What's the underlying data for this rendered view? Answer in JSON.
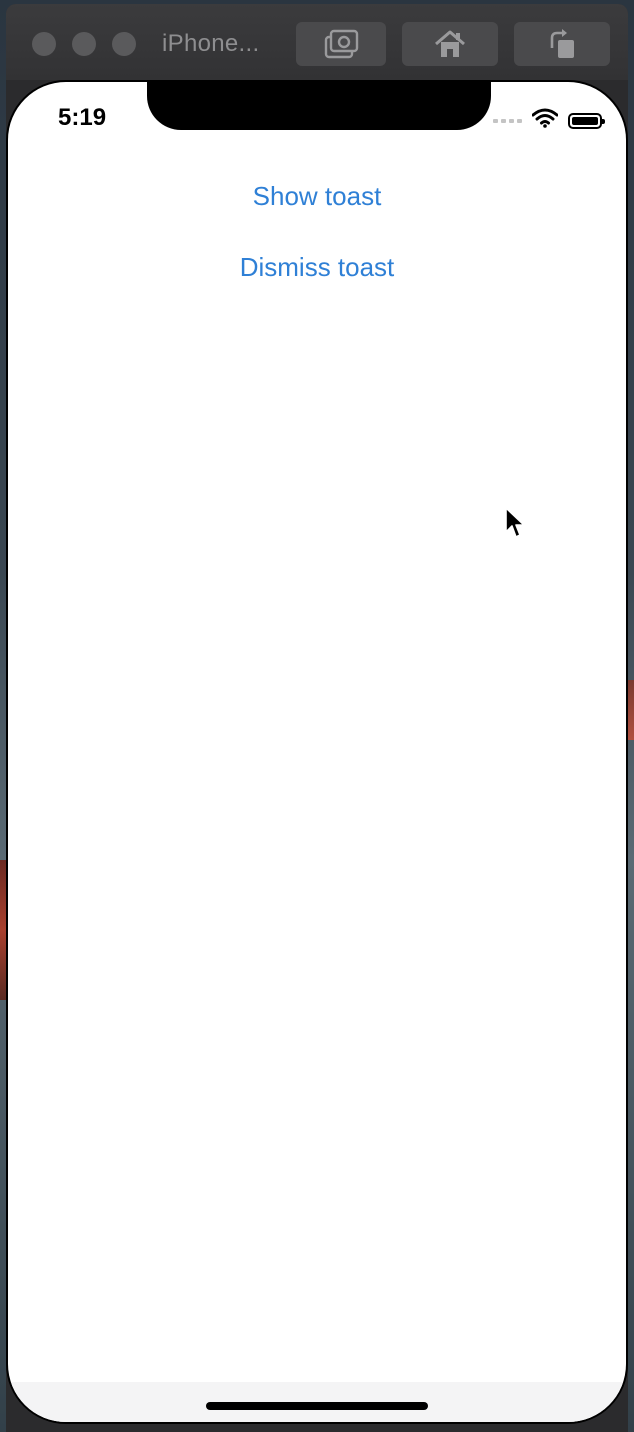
{
  "window": {
    "title": "iPhone...",
    "toolbar": [
      {
        "icon": "screenshot-camera-icon"
      },
      {
        "icon": "home-icon"
      },
      {
        "icon": "rotate-icon"
      }
    ]
  },
  "status_bar": {
    "time": "5:19",
    "icons": [
      "cellular-signal-icon",
      "wifi-icon",
      "battery-icon"
    ]
  },
  "app": {
    "show_toast_label": "Show toast",
    "dismiss_toast_label": "Dismiss toast",
    "accent_color": "#2f80d6"
  }
}
